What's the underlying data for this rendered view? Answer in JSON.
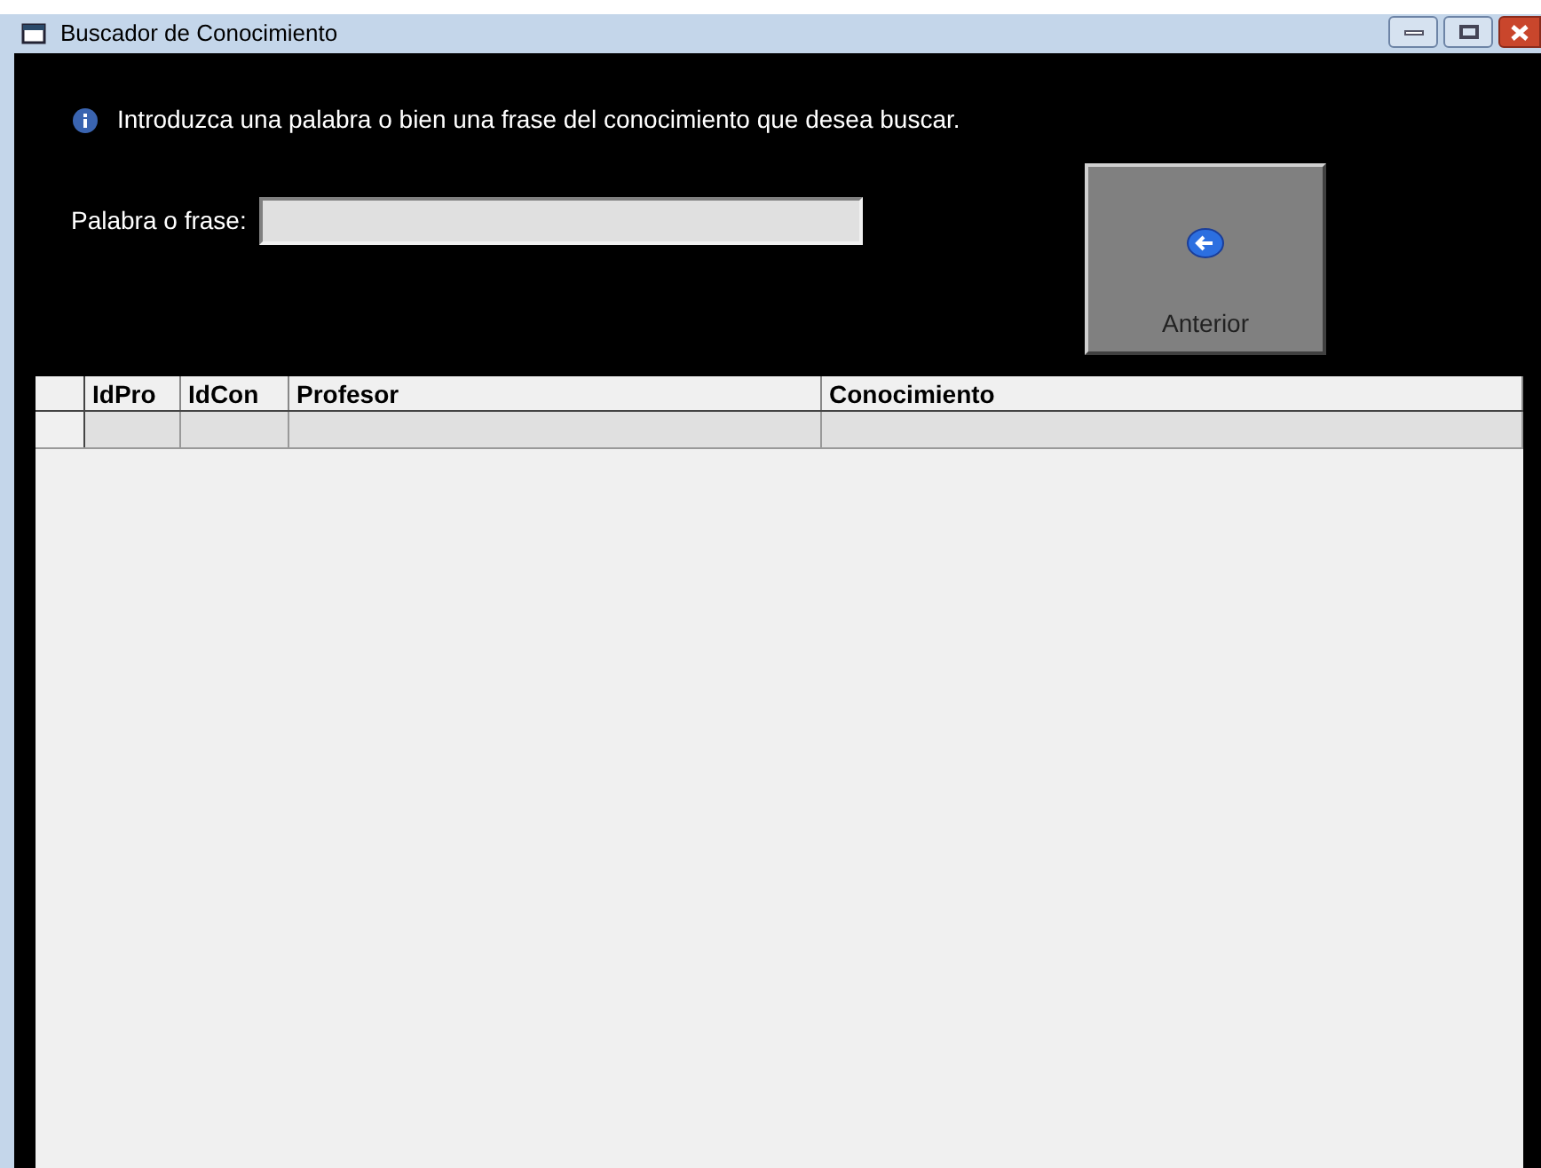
{
  "window": {
    "title": "Buscador de Conocimiento"
  },
  "info_message": "Introduzca una palabra o bien una frase del conocimiento que desea buscar.",
  "search": {
    "label": "Palabra o frase:"
  },
  "back_button": {
    "label": "Anterior"
  },
  "table": {
    "columns": [
      "IdPro",
      "IdCon",
      "Profesor",
      "Conocimiento"
    ]
  }
}
